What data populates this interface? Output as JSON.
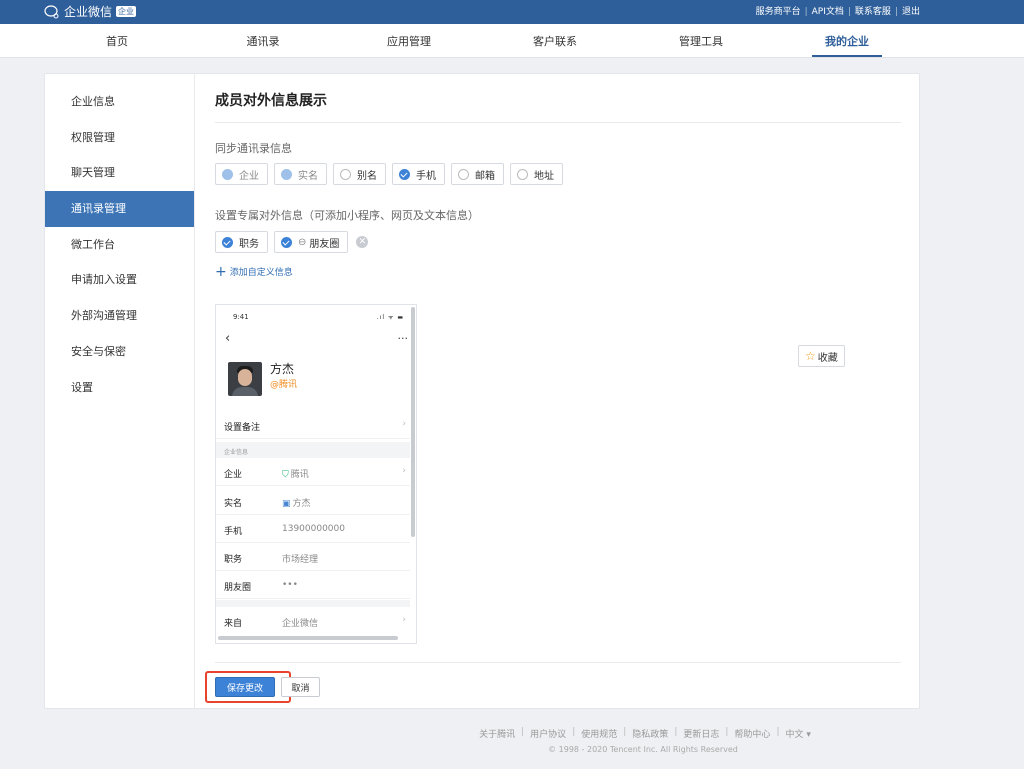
{
  "topbar": {
    "app_name": "企业微信",
    "badge": "企业",
    "links": [
      "服务商平台",
      "API文档",
      "联系客服",
      "退出"
    ]
  },
  "nav": {
    "items": [
      "首页",
      "通讯录",
      "应用管理",
      "客户联系",
      "管理工具",
      "我的企业"
    ],
    "active": "我的企业"
  },
  "sidebar": {
    "items": [
      "企业信息",
      "权限管理",
      "聊天管理",
      "通讯录管理",
      "微工作台",
      "申请加入设置",
      "外部沟通管理",
      "安全与保密",
      "设置"
    ],
    "active": "通讯录管理"
  },
  "main": {
    "title": "成员对外信息展示",
    "sync_label": "同步通讯录信息",
    "sync_fields": [
      {
        "label": "企业",
        "state": "checked-disabled"
      },
      {
        "label": "实名",
        "state": "checked-disabled"
      },
      {
        "label": "别名",
        "state": "unchecked"
      },
      {
        "label": "手机",
        "state": "checked"
      },
      {
        "label": "邮箱",
        "state": "unchecked"
      },
      {
        "label": "地址",
        "state": "unchecked"
      }
    ],
    "custom_label": "设置专属对外信息（可添加小程序、网页及文本信息）",
    "custom_fields": [
      {
        "label": "职务",
        "state": "checked"
      },
      {
        "label": "朋友圈",
        "state": "checked",
        "icon": "link-icon",
        "removable": true
      }
    ],
    "add_link": "添加自定义信息",
    "favorite_button": "收藏",
    "save_button": "保存更改",
    "cancel_button": "取消"
  },
  "phone_preview": {
    "time": "9:41",
    "signal": ".ıl ᯤ ▬",
    "name": "方杰",
    "org": "@腾讯",
    "note_label": "设置备注",
    "section_label": "企业信息",
    "rows": [
      {
        "key": "企业",
        "value": "腾讯",
        "icon": "shield-check-icon"
      },
      {
        "key": "实名",
        "value": "方杰",
        "icon": "id-card-icon"
      },
      {
        "key": "手机",
        "value": "13900000000"
      },
      {
        "key": "职务",
        "value": "市场经理"
      },
      {
        "key": "朋友圈",
        "value": "•••"
      }
    ],
    "from_key": "来自",
    "from_value": "企业微信"
  },
  "footer": {
    "links": [
      "关于腾讯",
      "用户协议",
      "使用规范",
      "隐私政策",
      "更新日志",
      "帮助中心",
      "中文 ▾"
    ],
    "copyright": "© 1998 - 2020 Tencent Inc. All Rights Reserved"
  },
  "colors": {
    "brand": "#2f5f9a",
    "accent": "#3c82d6",
    "highlight": "#e8432c",
    "org_text": "#f28a1d"
  }
}
